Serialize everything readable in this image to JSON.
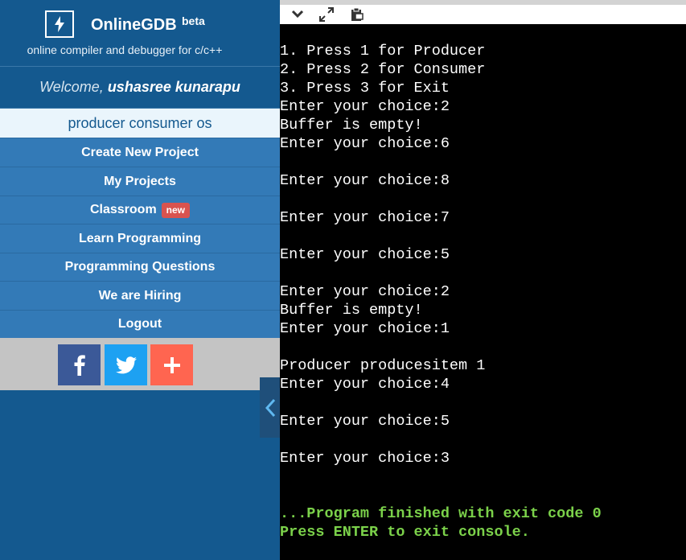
{
  "brand": {
    "name": "OnlineGDB",
    "beta": "beta",
    "tagline": "online compiler and debugger for c/c++"
  },
  "welcome": {
    "prefix": "Welcome,",
    "user": "ushasree kunarapu"
  },
  "project": {
    "name": "producer consumer os"
  },
  "nav": {
    "create": "Create New Project",
    "my_projects": "My Projects",
    "classroom": "Classroom",
    "classroom_badge": "new",
    "learn": "Learn Programming",
    "questions": "Programming Questions",
    "hiring": "We are Hiring",
    "logout": "Logout"
  },
  "social": {
    "icons": [
      "facebook-icon",
      "twitter-icon",
      "plus-icon"
    ],
    "colors": [
      "#3b5998",
      "#1da1f2",
      "#ff6550"
    ]
  },
  "toolbar": {
    "icons": [
      "chevron-down-icon",
      "expand-icon",
      "clipboard-icon"
    ]
  },
  "console": {
    "lines": [
      "1. Press 1 for Producer",
      "2. Press 2 for Consumer",
      "3. Press 3 for Exit",
      "Enter your choice:2",
      "Buffer is empty!",
      "Enter your choice:6",
      "",
      "Enter your choice:8",
      "",
      "Enter your choice:7",
      "",
      "Enter your choice:5",
      "",
      "Enter your choice:2",
      "Buffer is empty!",
      "Enter your choice:1",
      "",
      "Producer producesitem 1",
      "Enter your choice:4",
      "",
      "Enter your choice:5",
      "",
      "Enter your choice:3",
      "",
      "",
      "...Program finished with exit code 0",
      "Press ENTER to exit console."
    ],
    "status_color": "#7bd14a"
  },
  "colors": {
    "sidebar": "#14598f",
    "nav": "#337ab7",
    "badge": "#d9534f"
  }
}
